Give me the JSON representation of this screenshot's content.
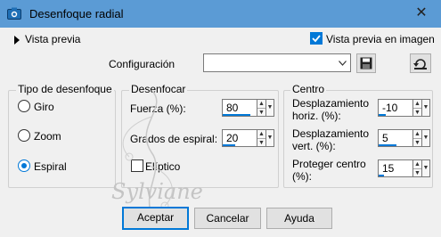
{
  "window": {
    "title": "Desenfoque radial",
    "close_glyph": "✕"
  },
  "top": {
    "preview_toggle": "Vista previa",
    "preview_in_image": "Vista previa en imagen",
    "preview_in_image_checked": true,
    "config_label": "Configuración",
    "config_value": ""
  },
  "blur_type": {
    "title": "Tipo de desenfoque",
    "options": [
      {
        "label": "Giro",
        "selected": false
      },
      {
        "label": "Zoom",
        "selected": false
      },
      {
        "label": "Espiral",
        "selected": true
      }
    ]
  },
  "blur": {
    "title": "Desenfocar",
    "strength_label": "Fuerza (%):",
    "strength_value": "80",
    "strength_fraction": 0.8,
    "spiral_label": "Grados de espiral:",
    "spiral_value": "20",
    "elliptic_label": "Elíptico",
    "elliptic_checked": false
  },
  "center": {
    "title": "Centro",
    "hoffset_label_1": "Desplazamiento",
    "hoffset_label_2": "horiz. (%):",
    "hoffset_value": "-10",
    "voffset_label_1": "Desplazamiento",
    "voffset_label_2": "vert. (%):",
    "voffset_value": "5",
    "protect_label_1": "Proteger centro",
    "protect_label_2": "(%):",
    "protect_value": "15"
  },
  "buttons": {
    "accept": "Aceptar",
    "cancel": "Cancelar",
    "help": "Ayuda"
  },
  "watermark": "Sylviane",
  "colors": {
    "titlebar": "#5b9bd5",
    "accent": "#0078d7"
  }
}
